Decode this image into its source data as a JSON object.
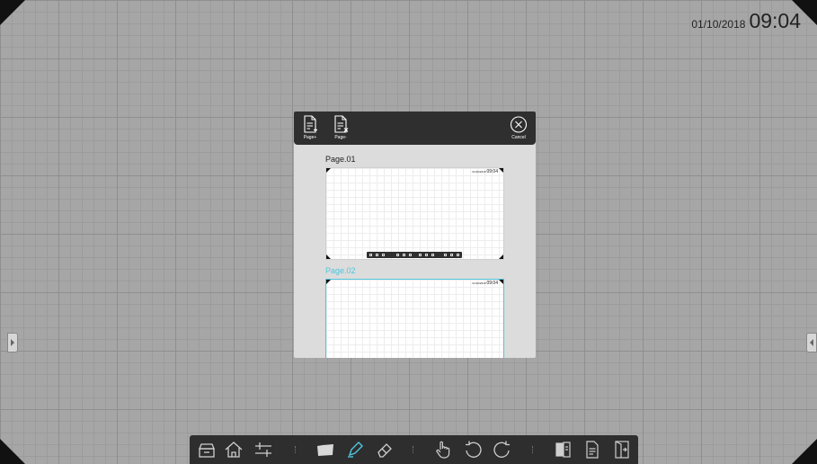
{
  "clock": {
    "date": "01/10/2018",
    "time": "09:04"
  },
  "dialog": {
    "page_add_label": "Page+",
    "page_remove_label": "Page-",
    "cancel_label": "Cancel",
    "pages": [
      {
        "label": "Page.01",
        "selected": false,
        "mini_date": "01/10/2018",
        "mini_time": "09:04"
      },
      {
        "label": "Page.02",
        "selected": true,
        "mini_date": "01/10/2018",
        "mini_time": "09:04"
      }
    ]
  },
  "colors": {
    "accent": "#4fc6dd",
    "toolbar_bg": "#2e2e2e",
    "dialog_bg": "#dcdcdc",
    "canvas_bg": "#a6a6a6"
  },
  "toolbar": {
    "icons": [
      "toolbox-icon",
      "home-icon",
      "settings-sliders-icon",
      "folder-icon",
      "pen-icon",
      "eraser-icon",
      "hand-icon",
      "undo-icon",
      "redo-icon",
      "page-manager-icon",
      "page-icon",
      "exit-icon"
    ]
  }
}
